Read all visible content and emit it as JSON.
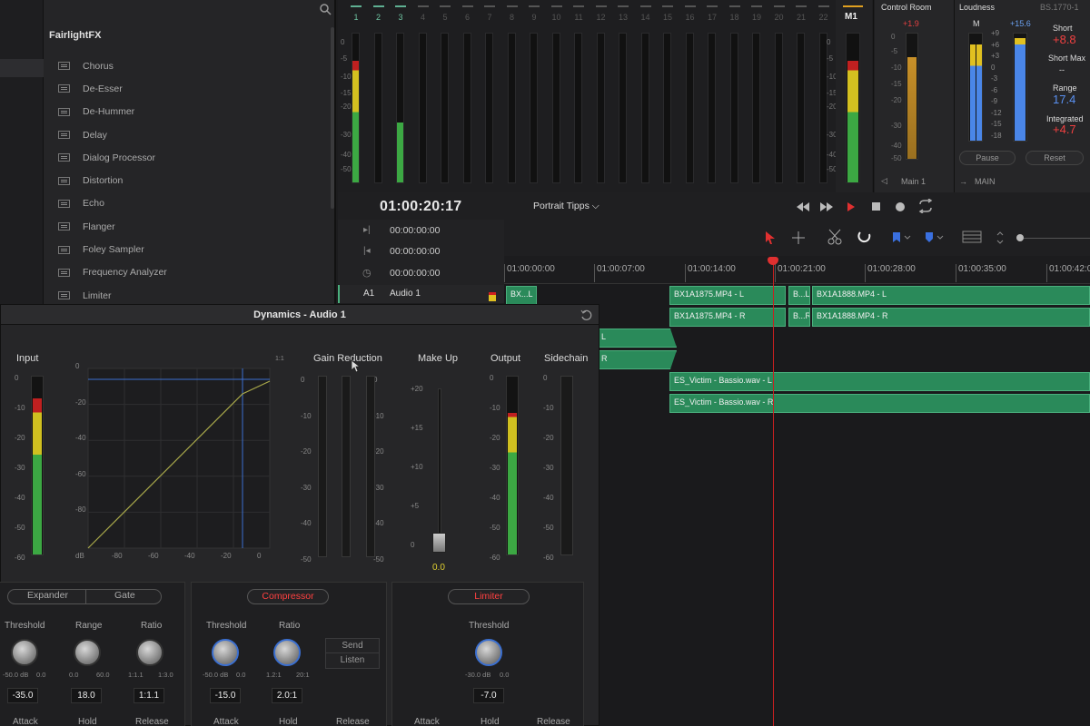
{
  "fx_panel": {
    "title": "FairlightFX",
    "items": [
      "Chorus",
      "De-Esser",
      "De-Hummer",
      "Delay",
      "Dialog Processor",
      "Distortion",
      "Echo",
      "Flanger",
      "Foley Sampler",
      "Frequency Analyzer",
      "Limiter"
    ]
  },
  "mixer": {
    "channel_numbers": [
      "1",
      "2",
      "3",
      "4",
      "5",
      "6",
      "7",
      "8",
      "9",
      "10",
      "11",
      "12",
      "13",
      "14",
      "15",
      "16",
      "17",
      "18",
      "19",
      "20",
      "21",
      "22"
    ],
    "scale": [
      "0",
      "-5",
      "-10",
      "-15",
      "-20",
      "-30",
      "-40",
      "-50"
    ],
    "master_label": "M1",
    "levels": {
      "ch1": 0.82,
      "ch2": 0.0,
      "ch3": 0.4,
      "m1": 0.82
    }
  },
  "control_room": {
    "title": "Control Room",
    "peak": "+1.9",
    "scale": [
      "0",
      "-5",
      "-10",
      "-15",
      "-20",
      "-30",
      "-40",
      "-50"
    ],
    "output": "Main 1"
  },
  "loudness": {
    "title": "Loudness",
    "standard": "BS.1770-1",
    "channel_label": "M",
    "peak": "+15.6",
    "scale": [
      "+9",
      "+6",
      "+3",
      "0",
      "-3",
      "-6",
      "-9",
      "-12",
      "-15",
      "-18"
    ],
    "short_label": "Short",
    "short_value": "+8.8",
    "short_max_label": "Short Max",
    "short_max_value": "--",
    "range_label": "Range",
    "range_value": "17.4",
    "integrated_label": "Integrated",
    "integrated_value": "+4.7",
    "pause_label": "Pause",
    "reset_label": "Reset",
    "main_label": "MAIN"
  },
  "transport": {
    "timecode": "01:00:20:17",
    "timeline_name": "Portrait Tipps",
    "in_tc": "00:00:00:00",
    "out_tc": "00:00:00:00",
    "dur_tc": "00:00:00:00"
  },
  "ruler": [
    "01:00:00:00",
    "01:00:07:00",
    "01:00:14:00",
    "01:00:21:00",
    "01:00:28:00",
    "01:00:35:00",
    "01:00:42:0"
  ],
  "tracks": {
    "a1_id": "A1",
    "a1_name": "Audio 1",
    "clips": {
      "c1": "BX...L",
      "c2": "BX1A1875.MP4 - L",
      "c3": "B...L",
      "c4": "BX1A1888.MP4 - L",
      "c5": "BX1A1875.MP4 - R",
      "c6": "B...R",
      "c7": "BX1A1888.MP4 - R",
      "c8": "L",
      "c9": "R",
      "c10": "ES_Victim - Bassio.wav - L",
      "c11": "ES_Victim - Bassio.wav - R"
    }
  },
  "dynamics": {
    "title": "Dynamics - Audio 1",
    "input_label": "Input",
    "gain_reduction_label": "Gain Reduction",
    "makeup_label": "Make Up",
    "output_label": "Output",
    "sidechain_label": "Sidechain",
    "ratio_mark": "1:1",
    "graph_y": [
      "0",
      "-20",
      "-40",
      "-60",
      "-80"
    ],
    "graph_x": [
      "dB",
      "-80",
      "-60",
      "-40",
      "-20",
      "0"
    ],
    "meter_scale": [
      "0",
      "-10",
      "-20",
      "-30",
      "-40",
      "-50",
      "-60"
    ],
    "gr_scale": [
      "0",
      "-10",
      "-20",
      "-30",
      "-40",
      "-50"
    ],
    "makeup_scale": [
      "+20",
      "+15",
      "+10",
      "+5",
      "0"
    ],
    "makeup_value": "0.0",
    "expander_tab": "Expander",
    "gate_tab": "Gate",
    "compressor_tab": "Compressor",
    "limiter_tab": "Limiter",
    "send_label": "Send",
    "listen_label": "Listen",
    "expander": {
      "threshold_label": "Threshold",
      "threshold_value": "-35.0",
      "threshold_min": "-50.0 dB",
      "threshold_max": "0.0",
      "range_label": "Range",
      "range_value": "18.0",
      "range_min": "0.0",
      "range_max": "60.0",
      "ratio_label": "Ratio",
      "ratio_value": "1:1.1",
      "ratio_min": "1:1.1",
      "ratio_max": "1:3.0",
      "attack_label": "Attack",
      "hold_label": "Hold",
      "release_label": "Release"
    },
    "compressor": {
      "threshold_label": "Threshold",
      "threshold_value": "-15.0",
      "threshold_min": "-50.0 dB",
      "threshold_max": "0.0",
      "ratio_label": "Ratio",
      "ratio_value": "2.0:1",
      "ratio_min": "1.2:1",
      "ratio_max": "20:1",
      "attack_label": "Attack",
      "hold_label": "Hold",
      "release_label": "Release"
    },
    "limiter": {
      "threshold_label": "Threshold",
      "threshold_value": "-7.0",
      "threshold_min": "-30.0 dB",
      "threshold_max": "0.0",
      "attack_label": "Attack",
      "hold_label": "Hold",
      "release_label": "Release"
    }
  },
  "colors": {
    "clip": "#2a8a5a",
    "accent_red": "#ff4040",
    "accent_blue": "#3b6fd0",
    "meter_green": "#3ca843",
    "meter_yellow": "#d4c020"
  }
}
